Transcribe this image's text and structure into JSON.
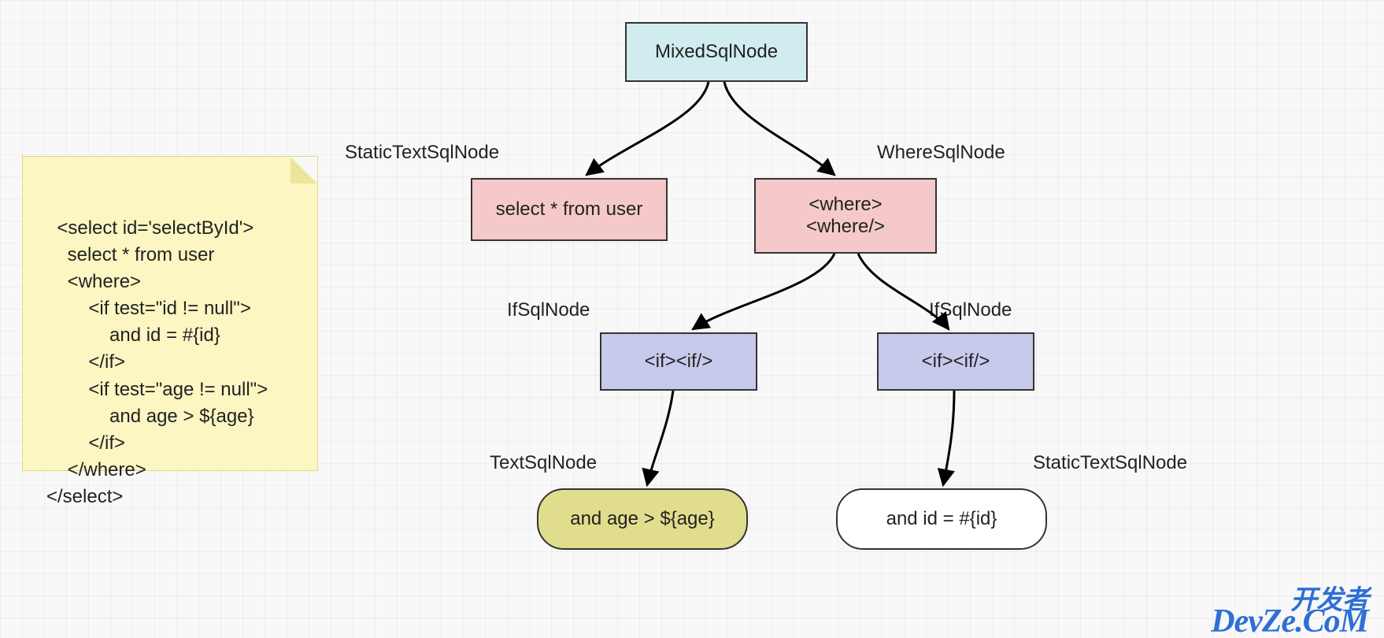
{
  "note_code": "<select id='selectById'>\n    select * from user\n    <where>\n        <if test=\"id != null\">\n            and id = #{id}\n        </if>\n        <if test=\"age != null\">\n            and age > ${age}\n        </if>\n    </where>\n</select>",
  "nodes": {
    "root": {
      "label": "MixedSqlNode"
    },
    "static1": {
      "label": "select * from user",
      "type_label": "StaticTextSqlNode"
    },
    "where": {
      "label": "<where>\n<where/>",
      "type_label": "WhereSqlNode"
    },
    "if_left": {
      "label": "<if><if/>",
      "type_label": "IfSqlNode"
    },
    "if_right": {
      "label": "<if><if/>",
      "type_label": "IfSqlNode"
    },
    "text_leaf": {
      "label": "and age > ${age}",
      "type_label": "TextSqlNode"
    },
    "static_leaf": {
      "label": "and id = #{id}",
      "type_label": "StaticTextSqlNode"
    }
  },
  "watermark": {
    "line1": "开发者",
    "line2": "DevZe.CoM"
  }
}
